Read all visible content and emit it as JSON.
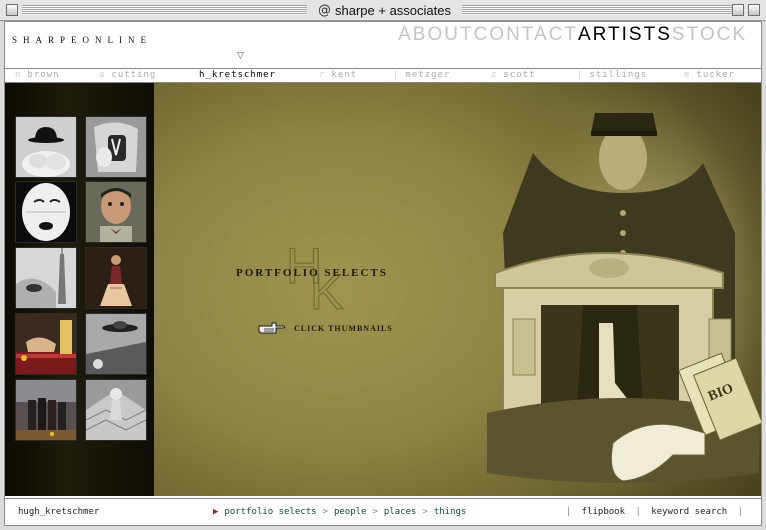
{
  "window": {
    "title": "sharpe + associates",
    "title_icon": "@"
  },
  "header": {
    "brand": "SHARPEONLINE",
    "nav": [
      {
        "label": "ABOUT",
        "active": false
      },
      {
        "label": "CONTACT",
        "active": false
      },
      {
        "label": "ARTISTS",
        "active": true
      },
      {
        "label": "STOCK",
        "active": false
      }
    ],
    "marker": "▽"
  },
  "artists": [
    {
      "initial": "n",
      "name": "brown",
      "active": false
    },
    {
      "initial": "a",
      "name": "cutting",
      "active": false
    },
    {
      "initial": "",
      "name": "h_kretschmer",
      "active": true
    },
    {
      "initial": "r",
      "name": "kent",
      "active": false
    },
    {
      "initial": "|",
      "name": "metzger",
      "active": false
    },
    {
      "initial": "z",
      "name": "scott",
      "active": false
    },
    {
      "initial": "|",
      "name": "stillings",
      "active": false
    },
    {
      "initial": "e",
      "name": "tucker",
      "active": false
    }
  ],
  "main": {
    "heading": "PORTFOLIO SELECTS",
    "monogram": "HK",
    "hint": "CLICK THUMBNAILS",
    "hint_icon": "pointing-hand-icon"
  },
  "footer": {
    "artist_name": "hugh_kretschmer",
    "breadcrumb_arrow": "▶",
    "breadcrumb": [
      "portfolio selects",
      "people",
      "places",
      "things"
    ],
    "breadcrumb_separator": ">",
    "links": [
      "flipbook",
      "keyword search"
    ],
    "link_separator": "|"
  },
  "colors": {
    "olive_background": "#8a8140",
    "active_nav": "#000000",
    "inactive_nav": "#c4c4c4",
    "breadcrumb_link": "#0f4d3a",
    "breadcrumb_arrow": "#8a2222"
  }
}
